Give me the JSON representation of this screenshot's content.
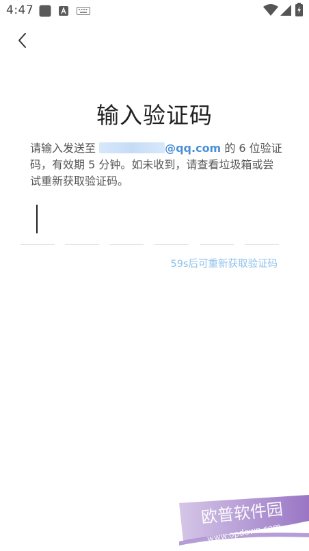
{
  "status_bar": {
    "time": "4:47",
    "icons": [
      "app-square-icon",
      "a-notification-icon",
      "keyboard-icon",
      "wifi-icon",
      "signal-icon",
      "battery-charging-icon"
    ]
  },
  "nav": {
    "back_icon": "chevron-left-icon"
  },
  "title": "输入验证码",
  "description": {
    "prefix": "请输入发送至 ",
    "email_visible": "@qq.com",
    "suffix": " 的 6 位验证码，有效期 5 分钟。如未收到，请查看垃圾箱或尝试重新获取验证码。"
  },
  "code_input": {
    "length": 6,
    "filled": 0,
    "active_index": 0
  },
  "resend": {
    "label": "59s后可重新获取验证码"
  },
  "watermark": {
    "text": "欧普软件园",
    "url": "www.opdown.com"
  },
  "colors": {
    "accent": "#4a90d9",
    "resend": "#8dc0ec",
    "divider": "#dcdcdc",
    "watermark": "#7b4fb0"
  }
}
